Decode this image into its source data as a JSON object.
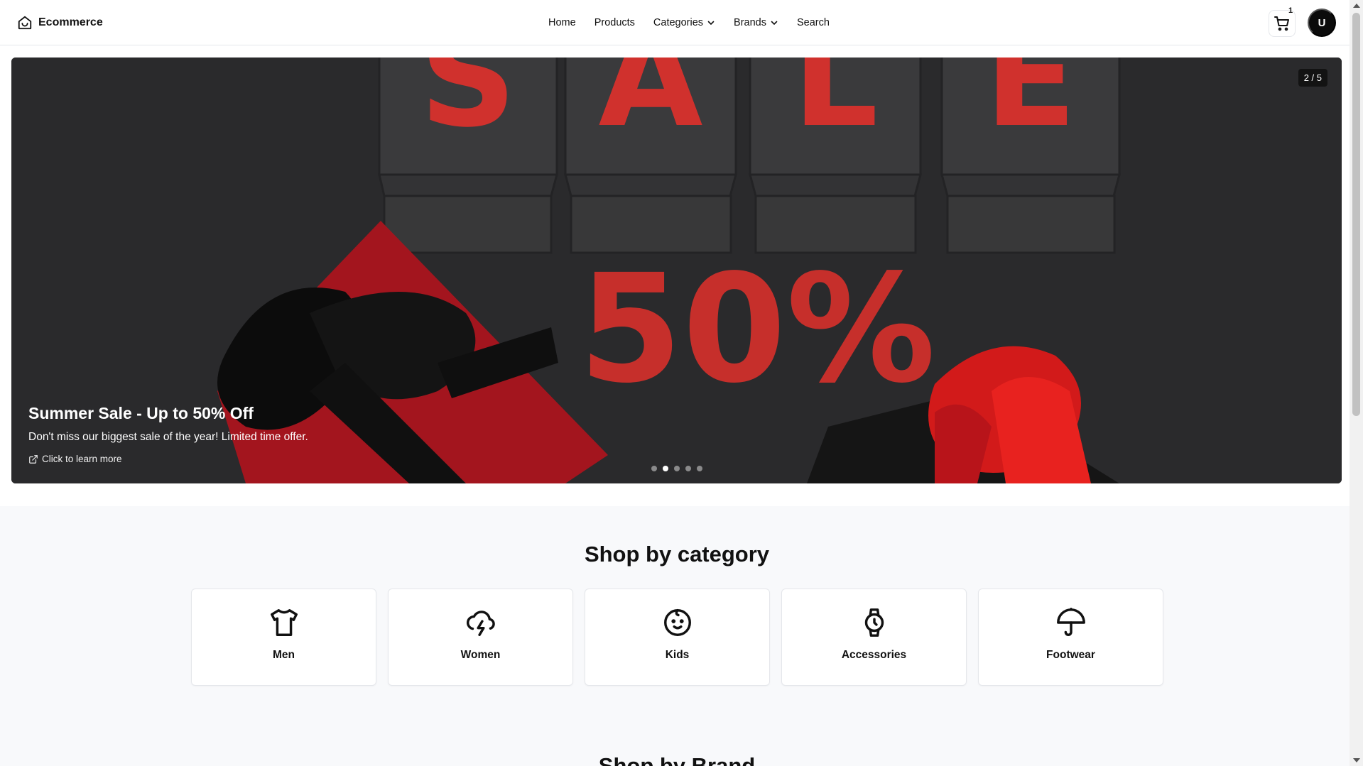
{
  "header": {
    "brand": "Ecommerce",
    "nav": [
      {
        "label": "Home",
        "has_dropdown": false
      },
      {
        "label": "Products",
        "has_dropdown": false
      },
      {
        "label": "Categories",
        "has_dropdown": true
      },
      {
        "label": "Brands",
        "has_dropdown": true
      },
      {
        "label": "Search",
        "has_dropdown": false
      }
    ],
    "cart_count": "1",
    "avatar_initial": "U"
  },
  "hero": {
    "slide_counter": "2 / 5",
    "title": "Summer Sale - Up to 50% Off",
    "subtitle": "Don't miss our biggest sale of the year! Limited time offer.",
    "link_text": "Click to learn more",
    "dot_count": 5,
    "active_dot": 2,
    "image_letters": [
      "S",
      "A",
      "L",
      "E"
    ],
    "image_percent": "50%",
    "colors": {
      "background": "#2b2b2d",
      "accent_red": "#d0312d",
      "bag": "#3a3a3c"
    }
  },
  "categories": {
    "title": "Shop by category",
    "items": [
      {
        "label": "Men",
        "icon": "shirt-icon"
      },
      {
        "label": "Women",
        "icon": "cloud-lightning-icon"
      },
      {
        "label": "Kids",
        "icon": "baby-face-icon"
      },
      {
        "label": "Accessories",
        "icon": "watch-icon"
      },
      {
        "label": "Footwear",
        "icon": "umbrella-icon"
      }
    ]
  },
  "brands": {
    "title": "Shop by Brand"
  }
}
